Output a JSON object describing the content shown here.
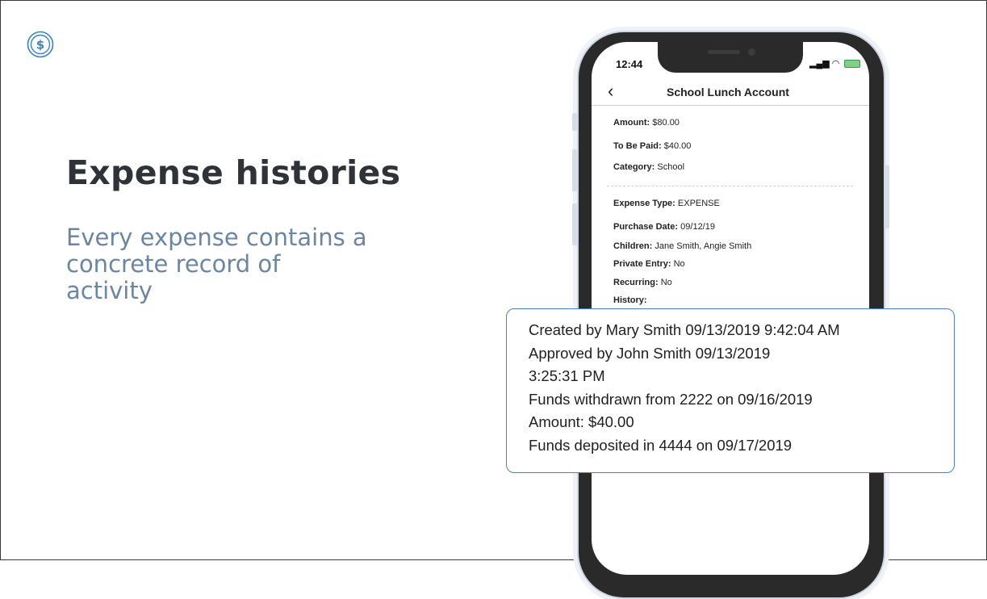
{
  "slide": {
    "title": "Expense histories",
    "subtitle": "Every expense contains a\nconcrete record of\nactivity",
    "logo_icon": "dollar-circle-icon",
    "accent_color": "#4c7fc4"
  },
  "phone": {
    "status_time": "12:44",
    "status_icons": "signal-wifi-battery",
    "nav_title": "School Lunch Account",
    "back_icon": "chevron-left-icon",
    "fields_top": [
      {
        "label": "Amount:",
        "value": "$80.00"
      },
      {
        "label": "To Be Paid:",
        "value": "$40.00"
      },
      {
        "label": "Category:",
        "value": "School"
      }
    ],
    "fields_detail": [
      {
        "label": "Expense Type:",
        "value": "EXPENSE"
      },
      {
        "label": "Purchase Date:",
        "value": "09/12/19"
      },
      {
        "label": "Children:",
        "value": "Jane Smith, Angie Smith"
      },
      {
        "label": "Private Entry:",
        "value": "No"
      },
      {
        "label": "Recurring:",
        "value": "No"
      },
      {
        "label": "History:",
        "value": ""
      }
    ]
  },
  "history_callout": {
    "lines": [
      "Created by Mary Smith 09/13/2019 9:42:04 AM",
      "Approved by John Smith 09/13/2019",
      "3:25:31 PM",
      "Funds withdrawn from 2222 on 09/16/2019",
      "Amount: $40.00",
      "Funds deposited in 4444 on 09/17/2019"
    ]
  }
}
